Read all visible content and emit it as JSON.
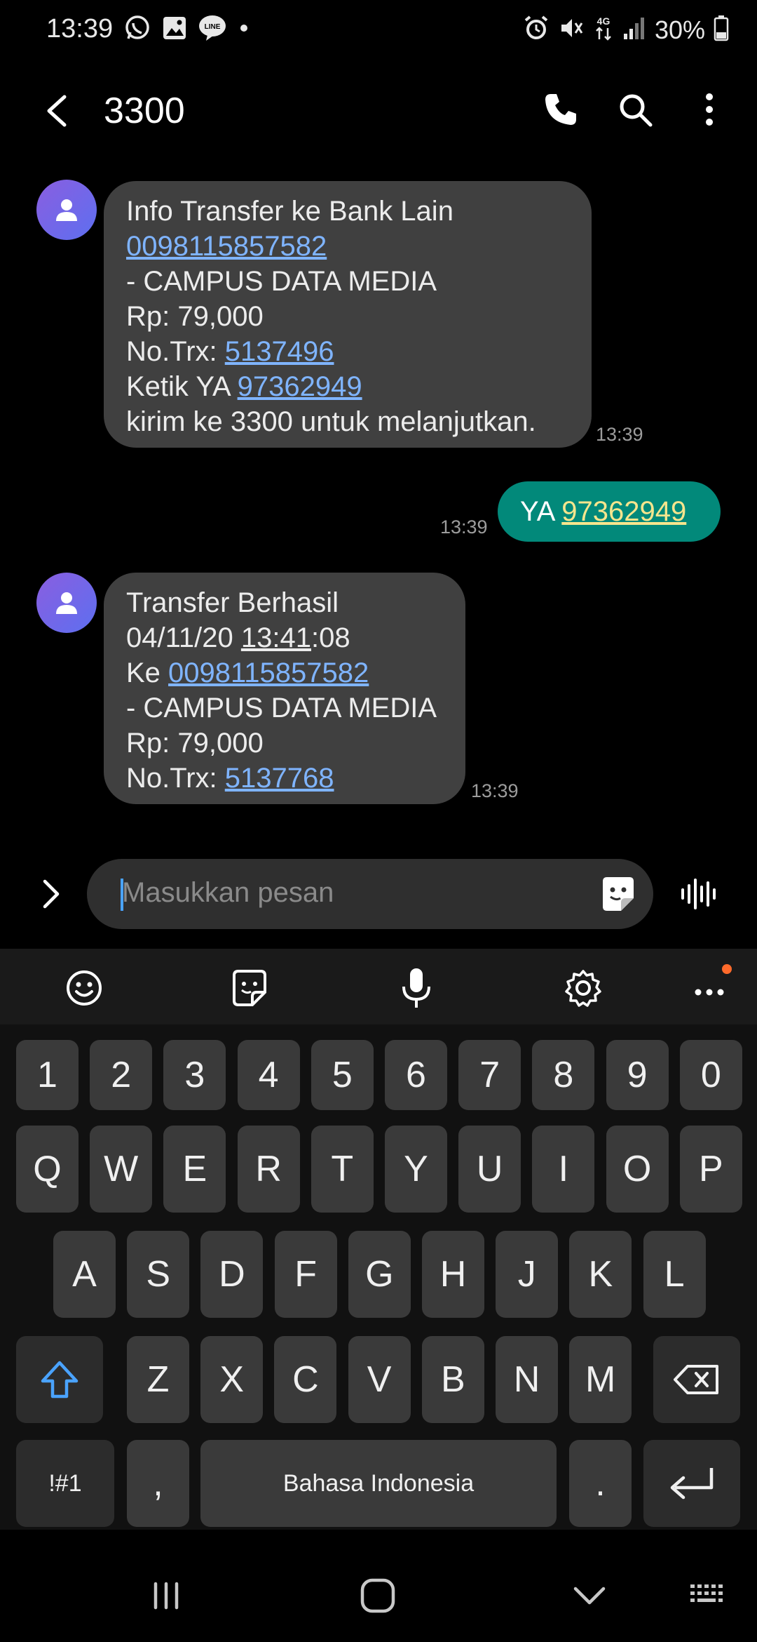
{
  "status_bar": {
    "time": "13:39",
    "battery_text": "30%",
    "network_label": "4G"
  },
  "app_bar": {
    "title": "3300"
  },
  "messages": [
    {
      "lines": [
        {
          "parts": [
            {
              "text": "Info Transfer ke Bank Lain"
            }
          ]
        },
        {
          "parts": [
            {
              "text": "0098115857582",
              "link": true
            }
          ]
        },
        {
          "parts": [
            {
              "text": "- CAMPUS DATA MEDIA"
            }
          ]
        },
        {
          "parts": [
            {
              "text": "Rp: 79,000"
            }
          ]
        },
        {
          "parts": [
            {
              "text": "No.Trx: "
            },
            {
              "text": "5137496",
              "link": true
            }
          ]
        },
        {
          "parts": [
            {
              "text": "Ketik YA "
            },
            {
              "text": "97362949",
              "link": true
            }
          ]
        },
        {
          "parts": [
            {
              "text": "kirim ke 3300 untuk melanjutkan."
            }
          ]
        }
      ],
      "time": "13:39"
    },
    {
      "lines": [
        {
          "parts": [
            {
              "text": "Transfer Berhasil"
            }
          ]
        },
        {
          "parts": [
            {
              "text": "04/11/20 "
            },
            {
              "text": "13:41",
              "underline": true
            },
            {
              "text": ":08"
            }
          ]
        },
        {
          "parts": [
            {
              "text": "Ke "
            },
            {
              "text": "0098115857582",
              "link": true
            }
          ]
        },
        {
          "parts": [
            {
              "text": "- CAMPUS DATA MEDIA"
            }
          ]
        },
        {
          "parts": [
            {
              "text": "Rp: 79,000"
            }
          ]
        },
        {
          "parts": [
            {
              "text": "No.Trx: "
            },
            {
              "text": "5137768",
              "link": true
            }
          ]
        }
      ],
      "time": "13:39"
    }
  ],
  "outgoing": {
    "prefix": "YA ",
    "code": "97362949",
    "time": "13:39"
  },
  "composer": {
    "placeholder": "Masukkan pesan"
  },
  "keyboard": {
    "number_row": [
      "1",
      "2",
      "3",
      "4",
      "5",
      "6",
      "7",
      "8",
      "9",
      "0"
    ],
    "row1": [
      "Q",
      "W",
      "E",
      "R",
      "T",
      "Y",
      "U",
      "I",
      "O",
      "P"
    ],
    "row2": [
      "A",
      "S",
      "D",
      "F",
      "G",
      "H",
      "J",
      "K",
      "L"
    ],
    "row3": [
      "Z",
      "X",
      "C",
      "V",
      "B",
      "N",
      "M"
    ],
    "symbols_label": "!#1",
    "comma_label": ",",
    "space_label": "Bahasa Indonesia",
    "period_label": "."
  },
  "colors": {
    "incoming_bubble": "#404040",
    "outgoing_bubble": "#02897a",
    "link": "#7fb4ff",
    "accent_caret": "#4aa3ff",
    "notif_dot": "#ff6a2b"
  }
}
